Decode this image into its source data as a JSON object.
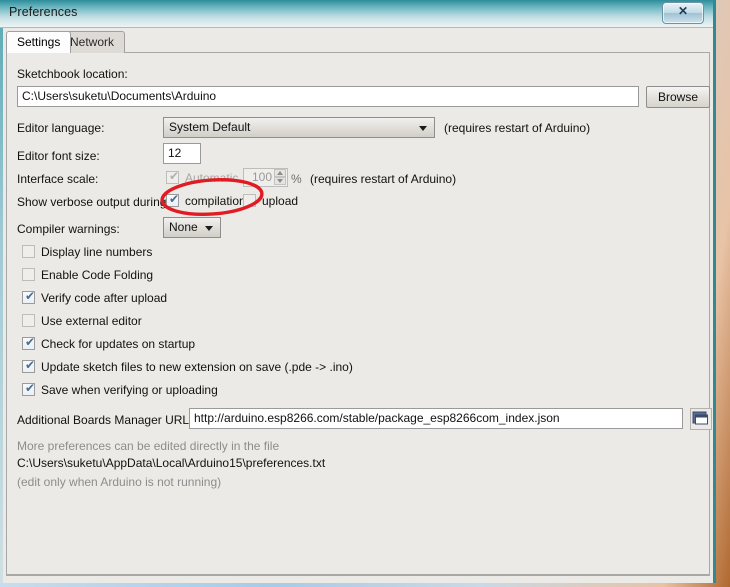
{
  "window": {
    "title": "Preferences",
    "close_label": "✕",
    "close_icon": "close-icon"
  },
  "tabs": [
    {
      "label": "Settings",
      "active": true
    },
    {
      "label": "Network",
      "active": false
    }
  ],
  "settings": {
    "sketchbook": {
      "label": "Sketchbook location:",
      "value": "C:\\Users\\suketu\\Documents\\Arduino",
      "browse_label": "Browse"
    },
    "editor_language": {
      "label": "Editor language:",
      "value": "System Default",
      "note": "(requires restart of Arduino)"
    },
    "editor_font_size": {
      "label": "Editor font size:",
      "value": "12"
    },
    "interface_scale": {
      "label": "Interface scale:",
      "automatic_label": "Automatic",
      "automatic_checked": true,
      "scale_value": "100",
      "percent_label": "%",
      "note": "(requires restart of Arduino)"
    },
    "verbose_output": {
      "label": "Show verbose output during:",
      "compilation_label": "compilation",
      "compilation_checked": true,
      "upload_label": "upload",
      "upload_checked": false
    },
    "compiler_warnings": {
      "label": "Compiler warnings:",
      "value": "None"
    },
    "checkboxes": [
      {
        "label": "Display line numbers",
        "checked": false
      },
      {
        "label": "Enable Code Folding",
        "checked": false
      },
      {
        "label": "Verify code after upload",
        "checked": true
      },
      {
        "label": "Use external editor",
        "checked": false
      },
      {
        "label": "Check for updates on startup",
        "checked": true
      },
      {
        "label": "Update sketch files to new extension on save (.pde -> .ino)",
        "checked": true
      },
      {
        "label": "Save when verifying or uploading",
        "checked": true
      }
    ],
    "boards_manager": {
      "label": "Additional Boards Manager URLs:",
      "value": "http://arduino.esp8266.com/stable/package_esp8266com_index.json",
      "icon": "open-window-icon"
    },
    "footer": {
      "line1": "More preferences can be edited directly in the file",
      "line2": "C:\\Users\\suketu\\AppData\\Local\\Arduino15\\preferences.txt",
      "line3": "(edit only when Arduino is not running)"
    }
  },
  "annotation": {
    "shape": "ellipse",
    "color": "#e01b24",
    "target": "compilation checkbox"
  },
  "checkmark_glyph": "✔"
}
